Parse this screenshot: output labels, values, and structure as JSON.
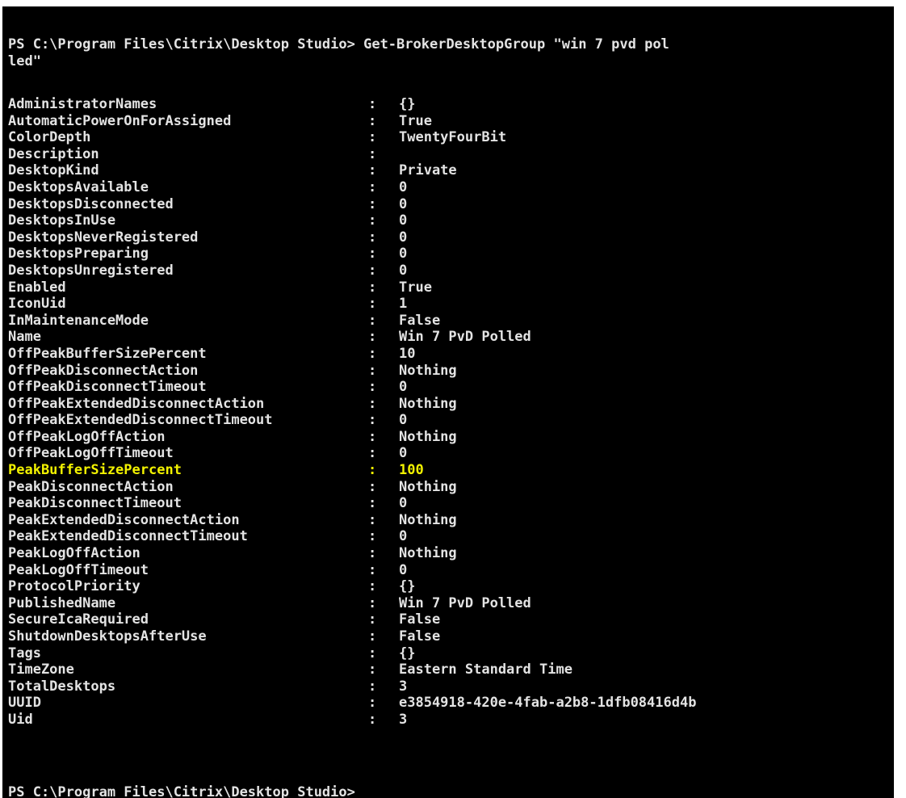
{
  "console": {
    "command_line_1": "PS C:\\Program Files\\Citrix\\Desktop Studio> Get-BrokerDesktopGroup \"win 7 pvd pol",
    "command_line_2": "led\"",
    "final_prompt": "PS C:\\Program Files\\Citrix\\Desktop Studio>",
    "separator": ":",
    "text_color": "#e3e3e3",
    "highlight_color": "#f2f200",
    "background_color": "#000000",
    "properties": [
      {
        "name": "AdministratorNames",
        "value": "{}"
      },
      {
        "name": "AutomaticPowerOnForAssigned",
        "value": "True"
      },
      {
        "name": "ColorDepth",
        "value": "TwentyFourBit"
      },
      {
        "name": "Description",
        "value": ""
      },
      {
        "name": "DesktopKind",
        "value": "Private"
      },
      {
        "name": "DesktopsAvailable",
        "value": "0"
      },
      {
        "name": "DesktopsDisconnected",
        "value": "0"
      },
      {
        "name": "DesktopsInUse",
        "value": "0"
      },
      {
        "name": "DesktopsNeverRegistered",
        "value": "0"
      },
      {
        "name": "DesktopsPreparing",
        "value": "0"
      },
      {
        "name": "DesktopsUnregistered",
        "value": "0"
      },
      {
        "name": "Enabled",
        "value": "True"
      },
      {
        "name": "IconUid",
        "value": "1"
      },
      {
        "name": "InMaintenanceMode",
        "value": "False"
      },
      {
        "name": "Name",
        "value": "Win 7 PvD Polled"
      },
      {
        "name": "OffPeakBufferSizePercent",
        "value": "10"
      },
      {
        "name": "OffPeakDisconnectAction",
        "value": "Nothing"
      },
      {
        "name": "OffPeakDisconnectTimeout",
        "value": "0"
      },
      {
        "name": "OffPeakExtendedDisconnectAction",
        "value": "Nothing"
      },
      {
        "name": "OffPeakExtendedDisconnectTimeout",
        "value": "0"
      },
      {
        "name": "OffPeakLogOffAction",
        "value": "Nothing"
      },
      {
        "name": "OffPeakLogOffTimeout",
        "value": "0"
      },
      {
        "name": "PeakBufferSizePercent",
        "value": "100",
        "highlighted": true
      },
      {
        "name": "PeakDisconnectAction",
        "value": "Nothing"
      },
      {
        "name": "PeakDisconnectTimeout",
        "value": "0"
      },
      {
        "name": "PeakExtendedDisconnectAction",
        "value": "Nothing"
      },
      {
        "name": "PeakExtendedDisconnectTimeout",
        "value": "0"
      },
      {
        "name": "PeakLogOffAction",
        "value": "Nothing"
      },
      {
        "name": "PeakLogOffTimeout",
        "value": "0"
      },
      {
        "name": "ProtocolPriority",
        "value": "{}"
      },
      {
        "name": "PublishedName",
        "value": "Win 7 PvD Polled"
      },
      {
        "name": "SecureIcaRequired",
        "value": "False"
      },
      {
        "name": "ShutdownDesktopsAfterUse",
        "value": "False"
      },
      {
        "name": "Tags",
        "value": "{}"
      },
      {
        "name": "TimeZone",
        "value": "Eastern Standard Time"
      },
      {
        "name": "TotalDesktops",
        "value": "3"
      },
      {
        "name": "UUID",
        "value": "e3854918-420e-4fab-a2b8-1dfb08416d4b"
      },
      {
        "name": "Uid",
        "value": "3"
      }
    ]
  }
}
